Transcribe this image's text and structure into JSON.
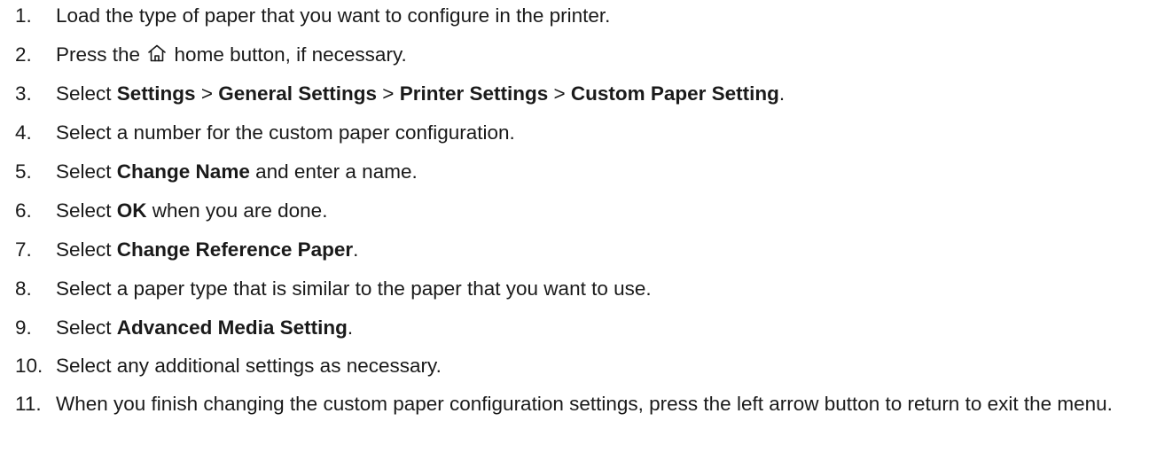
{
  "steps": [
    {
      "num": "1.",
      "parts": [
        {
          "t": "Load the type of paper that you want to configure in the printer."
        }
      ]
    },
    {
      "num": "2.",
      "parts": [
        {
          "t": "Press the "
        },
        {
          "icon": "home-icon"
        },
        {
          "t": " home button, if necessary."
        }
      ]
    },
    {
      "num": "3.",
      "parts": [
        {
          "t": "Select "
        },
        {
          "t": "Settings",
          "b": true
        },
        {
          "t": " > "
        },
        {
          "t": "General Settings",
          "b": true
        },
        {
          "t": " > "
        },
        {
          "t": "Printer Settings",
          "b": true
        },
        {
          "t": " > "
        },
        {
          "t": "Custom Paper Setting",
          "b": true
        },
        {
          "t": "."
        }
      ]
    },
    {
      "num": "4.",
      "parts": [
        {
          "t": "Select a number for the custom paper configuration."
        }
      ]
    },
    {
      "num": "5.",
      "parts": [
        {
          "t": "Select "
        },
        {
          "t": "Change Name",
          "b": true
        },
        {
          "t": " and enter a name."
        }
      ]
    },
    {
      "num": "6.",
      "parts": [
        {
          "t": "Select "
        },
        {
          "t": "OK",
          "b": true
        },
        {
          "t": " when you are done."
        }
      ]
    },
    {
      "num": "7.",
      "parts": [
        {
          "t": "Select "
        },
        {
          "t": "Change Reference Paper",
          "b": true
        },
        {
          "t": "."
        }
      ]
    },
    {
      "num": "8.",
      "parts": [
        {
          "t": "Select a paper type that is similar to the paper that you want to use."
        }
      ]
    },
    {
      "num": "9.",
      "parts": [
        {
          "t": "Select "
        },
        {
          "t": "Advanced Media Setting",
          "b": true
        },
        {
          "t": "."
        }
      ]
    },
    {
      "num": "10.",
      "parts": [
        {
          "t": "Select any additional settings as necessary."
        }
      ]
    },
    {
      "num": "11.",
      "parts": [
        {
          "t": "When you finish changing the custom paper configuration settings, press the left arrow button to return to exit the menu."
        }
      ]
    }
  ]
}
